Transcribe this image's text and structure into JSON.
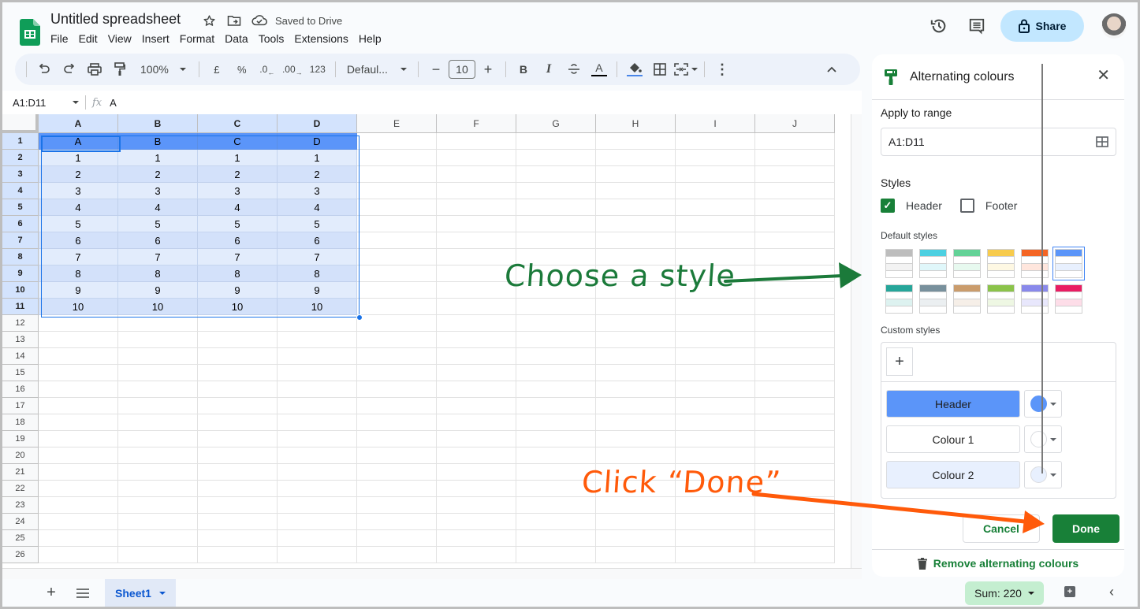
{
  "app": {
    "title": "Untitled spreadsheet",
    "save_status": "Saved to Drive",
    "menu": [
      "File",
      "Edit",
      "View",
      "Insert",
      "Format",
      "Data",
      "Tools",
      "Extensions",
      "Help"
    ],
    "share_label": "Share",
    "icons": [
      "sheets-logo",
      "star-icon",
      "move-to-folder-icon",
      "cloud-saved-icon",
      "version-history-icon",
      "comments-icon",
      "lock-icon",
      "avatar"
    ]
  },
  "toolbar": {
    "zoom": "100%",
    "currency": "£",
    "percent": "%",
    "decrease_decimal": ".0",
    "increase_decimal": ".00",
    "more_formats": "123",
    "font": "Defaul...",
    "font_size": "10",
    "bold": "B",
    "italic": "I",
    "underline_color": "A"
  },
  "formula_bar": {
    "name_box": "A1:D11",
    "fx": "fx",
    "content": "A"
  },
  "sheet": {
    "columns": [
      "A",
      "B",
      "C",
      "D",
      "E",
      "F",
      "G",
      "H",
      "I",
      "J"
    ],
    "row_count": 26,
    "data": [
      [
        "A",
        "B",
        "C",
        "D"
      ],
      [
        "1",
        "1",
        "1",
        "1"
      ],
      [
        "2",
        "2",
        "2",
        "2"
      ],
      [
        "3",
        "3",
        "3",
        "3"
      ],
      [
        "4",
        "4",
        "4",
        "4"
      ],
      [
        "5",
        "5",
        "5",
        "5"
      ],
      [
        "6",
        "6",
        "6",
        "6"
      ],
      [
        "7",
        "7",
        "7",
        "7"
      ],
      [
        "8",
        "8",
        "8",
        "8"
      ],
      [
        "9",
        "9",
        "9",
        "9"
      ],
      [
        "10",
        "10",
        "10",
        "10"
      ]
    ],
    "colors": {
      "header": "#5b95f9",
      "colour1": "#e2ecfc",
      "colour2": "#d3e1fa"
    }
  },
  "bottom_bar": {
    "sheet_tab": "Sheet1",
    "sum": "Sum: 220"
  },
  "panel": {
    "title": "Alternating colours",
    "apply_to_range_label": "Apply to range",
    "range_value": "A1:D11",
    "styles_label": "Styles",
    "header_checkbox": {
      "label": "Header",
      "checked": true
    },
    "footer_checkbox": {
      "label": "Footer",
      "checked": false
    },
    "default_styles_label": "Default styles",
    "default_styles": [
      {
        "name": "grey",
        "header": "#bdbdbd",
        "alt": "#f3f3f3"
      },
      {
        "name": "cyan",
        "header": "#4dd0e1",
        "alt": "#e0f7fa"
      },
      {
        "name": "green",
        "header": "#63d297",
        "alt": "#e7f9ef"
      },
      {
        "name": "yellow",
        "header": "#f7cb4d",
        "alt": "#fef8e3"
      },
      {
        "name": "orange",
        "header": "#f46524",
        "alt": "#ffe6dd"
      },
      {
        "name": "blue",
        "header": "#5b95f9",
        "alt": "#e8f0fe",
        "selected": true
      },
      {
        "name": "teal",
        "header": "#26a69a",
        "alt": "#ddf2f0"
      },
      {
        "name": "slate",
        "header": "#78909c",
        "alt": "#ebeff1"
      },
      {
        "name": "tan",
        "header": "#ca9c6c",
        "alt": "#f6efe8"
      },
      {
        "name": "lime",
        "header": "#8bc34a",
        "alt": "#eef7e3"
      },
      {
        "name": "lavender",
        "header": "#8989eb",
        "alt": "#e8e7fc"
      },
      {
        "name": "pink",
        "header": "#e91d63",
        "alt": "#fddde8"
      }
    ],
    "custom_styles_label": "Custom styles",
    "custom_styles": [
      {
        "label": "Header",
        "color": "#5b95f9"
      },
      {
        "label": "Colour 1",
        "color": "#ffffff"
      },
      {
        "label": "Colour 2",
        "color": "#e8f0fe"
      }
    ],
    "cancel_label": "Cancel",
    "done_label": "Done",
    "remove_label": "Remove alternating colours"
  },
  "annotations": {
    "choose_style": "Choose a style",
    "click_done": "Click “Done”"
  }
}
